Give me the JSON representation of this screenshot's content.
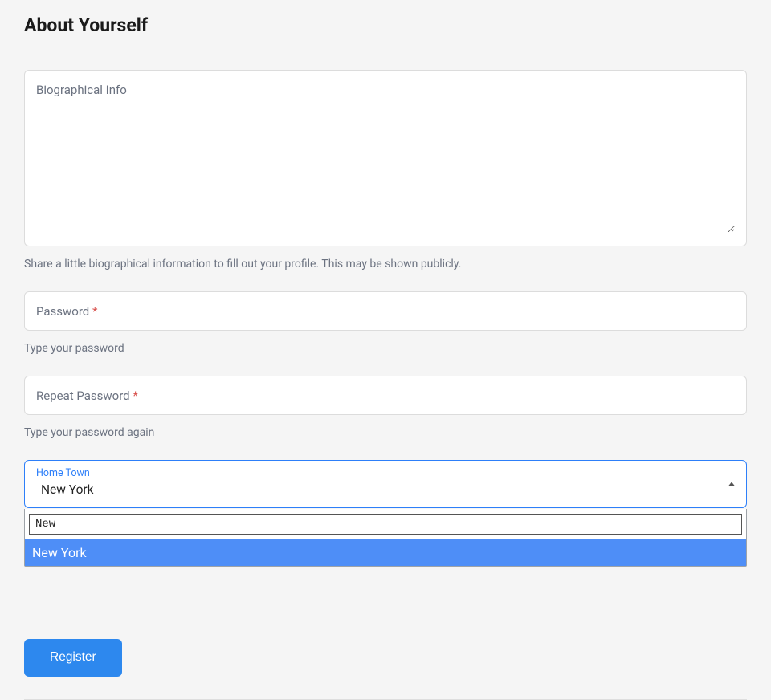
{
  "section": {
    "title": "About Yourself"
  },
  "bio": {
    "placeholder": "Biographical Info",
    "help": "Share a little biographical information to fill out your profile. This may be shown publicly."
  },
  "password": {
    "label": "Password",
    "required_mark": "*",
    "help": "Type your password"
  },
  "repeat_password": {
    "label": "Repeat Password",
    "required_mark": "*",
    "help": "Type your password again"
  },
  "hometown": {
    "label": "Home Town",
    "selected": "New York",
    "search_value": "New",
    "option_highlighted": "New York"
  },
  "actions": {
    "register_label": "Register"
  }
}
